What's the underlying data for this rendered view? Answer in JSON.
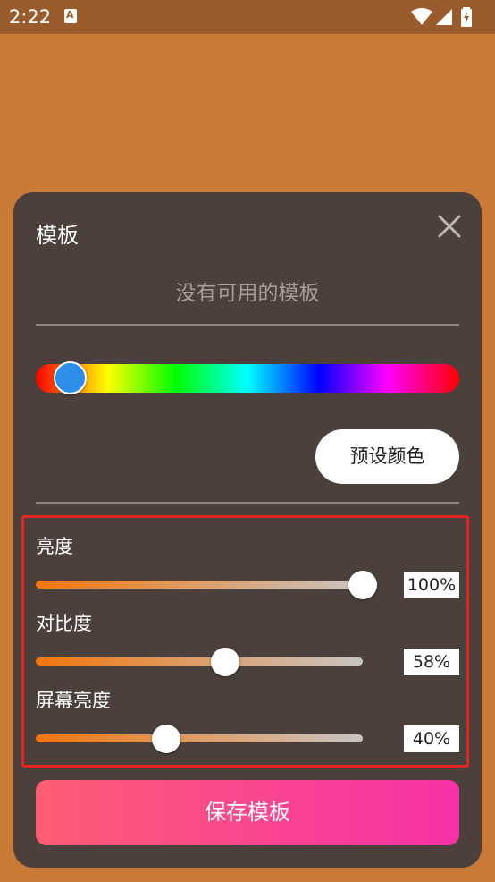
{
  "status_bar": {
    "time": "2:22",
    "icons": [
      "app-notification-icon",
      "wifi-icon",
      "signal-icon",
      "battery-icon"
    ]
  },
  "dialog": {
    "title": "模板",
    "empty_message": "没有可用的模板",
    "hue_slider": {
      "selected_color": "#2D8FEA"
    },
    "preset_button": "预设颜色",
    "sliders": [
      {
        "label": "亮度",
        "value_text": "100%",
        "value": 1.0
      },
      {
        "label": "对比度",
        "value_text": "58%",
        "value": 0.58
      },
      {
        "label": "屏幕亮度",
        "value_text": "40%",
        "value": 0.4
      }
    ],
    "save_button": "保存模板"
  },
  "colors": {
    "background": "#C97A37",
    "dialog_bg": "#4B403B",
    "highlight_border": "#E1261F",
    "save_gradient_start": "#FC5D73",
    "save_gradient_end": "#F731A8"
  }
}
